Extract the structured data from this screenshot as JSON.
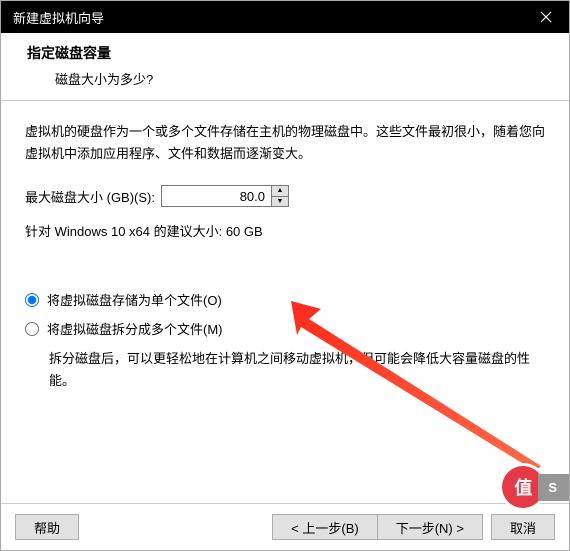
{
  "title": "新建虚拟机向导",
  "header": {
    "title": "指定磁盘容量",
    "subtitle": "磁盘大小为多少?"
  },
  "description": "虚拟机的硬盘作为一个或多个文件存储在主机的物理磁盘中。这些文件最初很小，随着您向虚拟机中添加应用程序、文件和数据而逐渐变大。",
  "disk": {
    "label": "最大磁盘大小 (GB)(S):",
    "value": "80.0",
    "recommend": "针对 Windows 10 x64 的建议大小: 60 GB"
  },
  "options": {
    "single": "将虚拟磁盘存储为单个文件(O)",
    "split": "将虚拟磁盘拆分成多个文件(M)",
    "split_desc": "拆分磁盘后，可以更轻松地在计算机之间移动虚拟机，但可能会降低大容量磁盘的性能。"
  },
  "buttons": {
    "help": "帮助",
    "back": "< 上一步(B)",
    "next": "下一步(N) >",
    "cancel": "取消"
  },
  "badge": {
    "icon": "值",
    "text": "S"
  }
}
